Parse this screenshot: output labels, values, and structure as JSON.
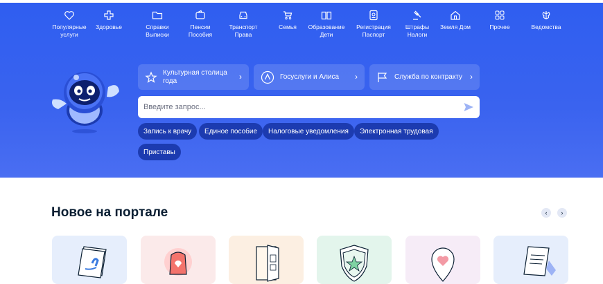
{
  "categories": [
    {
      "label": "Популярные\nуслуги",
      "icon": "heart-icon"
    },
    {
      "label": "Здоровье",
      "icon": "medical-cross-icon"
    },
    {
      "label": "Справки\nВыписки",
      "icon": "folder-icon"
    },
    {
      "label": "Пенсии\nПособия",
      "icon": "wallet-icon"
    },
    {
      "label": "Транспорт\nПрава",
      "icon": "car-icon"
    },
    {
      "label": "Семья",
      "icon": "stroller-icon"
    },
    {
      "label": "Образование\nДети",
      "icon": "book-icon"
    },
    {
      "label": "Регистрация\nПаспорт",
      "icon": "passport-icon"
    },
    {
      "label": "Штрафы\nНалоги",
      "icon": "gavel-icon"
    },
    {
      "label": "Земля Дом",
      "icon": "house-icon"
    },
    {
      "label": "Прочее",
      "icon": "grid-icon"
    },
    {
      "label": "Ведомства",
      "icon": "emblem-icon"
    }
  ],
  "quick_links": [
    {
      "label": "Культурная столица\nгода",
      "icon": "star-icon"
    },
    {
      "label": "Госуслуги и Алиса",
      "icon": "alice-icon"
    },
    {
      "label": "Служба по контракту",
      "icon": "flag-icon"
    }
  ],
  "search": {
    "placeholder": "Введите запрос..."
  },
  "tags": [
    "Запись к врачу",
    "Единое пособие",
    "Налоговые уведомления",
    "Электронная трудовая",
    "Приставы"
  ],
  "news": {
    "title": "Новое на портале",
    "prev": "‹",
    "next": "›",
    "cards": [
      {
        "icon": "document-icon"
      },
      {
        "icon": "siren-icon"
      },
      {
        "icon": "door-icon"
      },
      {
        "icon": "shield-star-icon"
      },
      {
        "icon": "heart-pin-icon"
      },
      {
        "icon": "certificate-icon"
      }
    ]
  },
  "colors": {
    "hero": "#3a63ef",
    "tag": "#1c3bb0",
    "heading": "#0b1f33"
  }
}
